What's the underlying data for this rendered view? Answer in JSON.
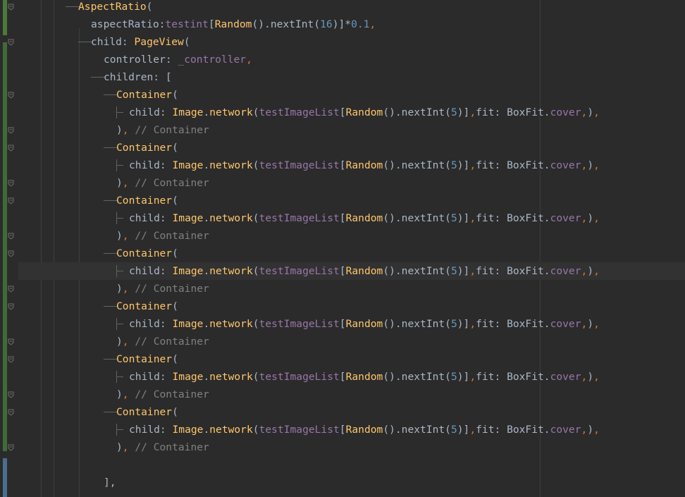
{
  "editor": {
    "lines": [
      {
        "indent": 3,
        "tokens": [
          [
            "cls",
            "AspectRatio"
          ],
          [
            "plain",
            "("
          ]
        ]
      },
      {
        "indent": 4,
        "tokens": [
          [
            "plain",
            "aspectRatio:"
          ],
          [
            "pur",
            "testint"
          ],
          [
            "plain",
            "["
          ],
          [
            "cls",
            "Random"
          ],
          [
            "plain",
            "().nextInt("
          ],
          [
            "num",
            "16"
          ],
          [
            "plain",
            ")]*"
          ],
          [
            "num",
            "0.1"
          ],
          [
            "kw",
            ","
          ]
        ]
      },
      {
        "indent": 4,
        "tokens": [
          [
            "plain",
            "child: "
          ],
          [
            "cls",
            "PageView"
          ],
          [
            "plain",
            "("
          ]
        ]
      },
      {
        "indent": 5,
        "tokens": [
          [
            "plain",
            "controller: "
          ],
          [
            "pur",
            "_controller"
          ],
          [
            "kw",
            ","
          ]
        ]
      },
      {
        "indent": 5,
        "tokens": [
          [
            "plain",
            "children: ["
          ]
        ]
      },
      {
        "indent": 6,
        "tokens": [
          [
            "cls",
            "Container"
          ],
          [
            "plain",
            "("
          ]
        ]
      },
      {
        "indent": 7,
        "tokens": [
          [
            "plain",
            "child: "
          ],
          [
            "cls",
            "Image"
          ],
          [
            "plain",
            "."
          ],
          [
            "fn",
            "network"
          ],
          [
            "plain",
            "("
          ],
          [
            "pur",
            "testImageList"
          ],
          [
            "plain",
            "["
          ],
          [
            "cls",
            "Random"
          ],
          [
            "plain",
            "().nextInt("
          ],
          [
            "num",
            "5"
          ],
          [
            "plain",
            ")]"
          ],
          [
            "kw",
            ","
          ],
          [
            "plain",
            "fit: BoxFit."
          ],
          [
            "pur",
            "cover"
          ],
          [
            "kw",
            ","
          ],
          [
            "plain",
            ")"
          ],
          [
            "kw",
            ","
          ]
        ]
      },
      {
        "indent": 6,
        "tokens": [
          [
            "plain",
            ")"
          ],
          [
            "kw",
            ","
          ],
          [
            "cm",
            " // Container"
          ]
        ]
      },
      {
        "indent": 6,
        "tokens": [
          [
            "cls",
            "Container"
          ],
          [
            "plain",
            "("
          ]
        ]
      },
      {
        "indent": 7,
        "tokens": [
          [
            "plain",
            "child: "
          ],
          [
            "cls",
            "Image"
          ],
          [
            "plain",
            "."
          ],
          [
            "fn",
            "network"
          ],
          [
            "plain",
            "("
          ],
          [
            "pur",
            "testImageList"
          ],
          [
            "plain",
            "["
          ],
          [
            "cls",
            "Random"
          ],
          [
            "plain",
            "().nextInt("
          ],
          [
            "num",
            "5"
          ],
          [
            "plain",
            ")]"
          ],
          [
            "kw",
            ","
          ],
          [
            "plain",
            "fit: BoxFit."
          ],
          [
            "pur",
            "cover"
          ],
          [
            "kw",
            ","
          ],
          [
            "plain",
            ")"
          ],
          [
            "kw",
            ","
          ]
        ]
      },
      {
        "indent": 6,
        "tokens": [
          [
            "plain",
            ")"
          ],
          [
            "kw",
            ","
          ],
          [
            "cm",
            " // Container"
          ]
        ]
      },
      {
        "indent": 6,
        "tokens": [
          [
            "cls",
            "Container"
          ],
          [
            "plain",
            "("
          ]
        ]
      },
      {
        "indent": 7,
        "tokens": [
          [
            "plain",
            "child: "
          ],
          [
            "cls",
            "Image"
          ],
          [
            "plain",
            "."
          ],
          [
            "fn",
            "network"
          ],
          [
            "plain",
            "("
          ],
          [
            "pur",
            "testImageList"
          ],
          [
            "plain",
            "["
          ],
          [
            "cls",
            "Random"
          ],
          [
            "plain",
            "().nextInt("
          ],
          [
            "num",
            "5"
          ],
          [
            "plain",
            ")]"
          ],
          [
            "kw",
            ","
          ],
          [
            "plain",
            "fit: BoxFit."
          ],
          [
            "pur",
            "cover"
          ],
          [
            "kw",
            ","
          ],
          [
            "plain",
            ")"
          ],
          [
            "kw",
            ","
          ]
        ]
      },
      {
        "indent": 6,
        "tokens": [
          [
            "plain",
            ")"
          ],
          [
            "kw",
            ","
          ],
          [
            "cm",
            " // Container"
          ]
        ]
      },
      {
        "indent": 6,
        "tokens": [
          [
            "cls",
            "Container"
          ],
          [
            "plain",
            "("
          ]
        ]
      },
      {
        "indent": 7,
        "current": true,
        "tokens": [
          [
            "plain",
            "child: "
          ],
          [
            "cls",
            "Image"
          ],
          [
            "plain",
            "."
          ],
          [
            "fn",
            "network"
          ],
          [
            "plain",
            "("
          ],
          [
            "pur",
            "testImageList"
          ],
          [
            "plain",
            "["
          ],
          [
            "cls",
            "Random"
          ],
          [
            "plain",
            "().nextInt("
          ],
          [
            "num",
            "5"
          ],
          [
            "plain",
            ")]"
          ],
          [
            "kw",
            ","
          ],
          [
            "plain",
            "fit: BoxFit."
          ],
          [
            "pur",
            "cover"
          ],
          [
            "kw",
            ","
          ],
          [
            "plain",
            ")"
          ],
          [
            "kw",
            ","
          ]
        ]
      },
      {
        "indent": 6,
        "tokens": [
          [
            "plain",
            ")"
          ],
          [
            "kw",
            ","
          ],
          [
            "cm",
            " // Container"
          ]
        ]
      },
      {
        "indent": 6,
        "tokens": [
          [
            "cls",
            "Container"
          ],
          [
            "plain",
            "("
          ]
        ]
      },
      {
        "indent": 7,
        "tokens": [
          [
            "plain",
            "child: "
          ],
          [
            "cls",
            "Image"
          ],
          [
            "plain",
            "."
          ],
          [
            "fn",
            "network"
          ],
          [
            "plain",
            "("
          ],
          [
            "pur",
            "testImageList"
          ],
          [
            "plain",
            "["
          ],
          [
            "cls",
            "Random"
          ],
          [
            "plain",
            "().nextInt("
          ],
          [
            "num",
            "5"
          ],
          [
            "plain",
            ")]"
          ],
          [
            "kw",
            ","
          ],
          [
            "plain",
            "fit: BoxFit."
          ],
          [
            "pur",
            "cover"
          ],
          [
            "kw",
            ","
          ],
          [
            "plain",
            ")"
          ],
          [
            "kw",
            ","
          ]
        ]
      },
      {
        "indent": 6,
        "tokens": [
          [
            "plain",
            ")"
          ],
          [
            "kw",
            ","
          ],
          [
            "cm",
            " // Container"
          ]
        ]
      },
      {
        "indent": 6,
        "tokens": [
          [
            "cls",
            "Container"
          ],
          [
            "plain",
            "("
          ]
        ]
      },
      {
        "indent": 7,
        "tokens": [
          [
            "plain",
            "child: "
          ],
          [
            "cls",
            "Image"
          ],
          [
            "plain",
            "."
          ],
          [
            "fn",
            "network"
          ],
          [
            "plain",
            "("
          ],
          [
            "pur",
            "testImageList"
          ],
          [
            "plain",
            "["
          ],
          [
            "cls",
            "Random"
          ],
          [
            "plain",
            "().nextInt("
          ],
          [
            "num",
            "5"
          ],
          [
            "plain",
            ")]"
          ],
          [
            "kw",
            ","
          ],
          [
            "plain",
            "fit: BoxFit."
          ],
          [
            "pur",
            "cover"
          ],
          [
            "kw",
            ","
          ],
          [
            "plain",
            ")"
          ],
          [
            "kw",
            ","
          ]
        ]
      },
      {
        "indent": 6,
        "tokens": [
          [
            "plain",
            ")"
          ],
          [
            "kw",
            ","
          ],
          [
            "cm",
            " // Container"
          ]
        ]
      },
      {
        "indent": 6,
        "tokens": [
          [
            "cls",
            "Container"
          ],
          [
            "plain",
            "("
          ]
        ]
      },
      {
        "indent": 7,
        "tokens": [
          [
            "plain",
            "child: "
          ],
          [
            "cls",
            "Image"
          ],
          [
            "plain",
            "."
          ],
          [
            "fn",
            "network"
          ],
          [
            "plain",
            "("
          ],
          [
            "pur",
            "testImageList"
          ],
          [
            "plain",
            "["
          ],
          [
            "cls",
            "Random"
          ],
          [
            "plain",
            "().nextInt("
          ],
          [
            "num",
            "5"
          ],
          [
            "plain",
            ")]"
          ],
          [
            "kw",
            ","
          ],
          [
            "plain",
            "fit: BoxFit."
          ],
          [
            "pur",
            "cover"
          ],
          [
            "kw",
            ","
          ],
          [
            "plain",
            ")"
          ],
          [
            "kw",
            ","
          ]
        ]
      },
      {
        "indent": 6,
        "tokens": [
          [
            "plain",
            ")"
          ],
          [
            "kw",
            ","
          ],
          [
            "cm",
            " // Container"
          ]
        ]
      },
      {
        "indent": 5,
        "tokens": []
      },
      {
        "indent": 5,
        "tokens": [
          [
            "plain",
            "],"
          ]
        ]
      }
    ]
  },
  "colors": {
    "background": "#2b2b2b",
    "current_line": "#323232",
    "class": "#ffc66d",
    "field": "#9876aa",
    "number": "#6897bb",
    "keyword": "#cc7832",
    "comment": "#808080",
    "text": "#a9b7c6"
  },
  "gutter": {
    "fold_icons": "fold-marker-icon"
  }
}
